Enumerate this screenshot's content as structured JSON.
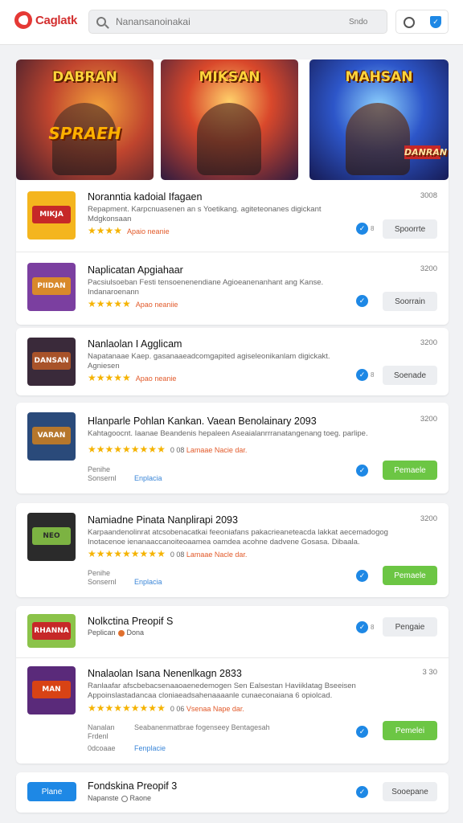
{
  "header": {
    "logo_text": "Caglatk",
    "search_placeholder": "Nanansanoinakai",
    "search_right": "Sndo"
  },
  "banners": [
    {
      "title": "DABRAN",
      "subtitle": "SPRAEH"
    },
    {
      "title": "MIKSAN",
      "subtitle": ""
    },
    {
      "title": "MAHSAN",
      "subtitle": "DANRAN"
    }
  ],
  "apps": [
    {
      "title": "Noranntia kadoial Ifagaen",
      "desc": "Repapment. Karpcnuasenen an s Yoetikang. agiteteonanes digickant Mdgkonsaan",
      "rating_meta": "Apaio neanie",
      "version": "3008",
      "check_label": "8",
      "button": "Spoorrte",
      "thumb_text": "MIKJA"
    },
    {
      "title": "Naplicatan Apgiahaar",
      "desc": "Pacsiulsoeban Festi tensoenenendiane Agioeanenanhant ang Kanse. Indanaroenann",
      "rating_meta": "Apao neaniie",
      "version": "3200",
      "button": "Soorrain",
      "thumb_text": "PIIDAN"
    },
    {
      "title": "Nanlaolan I Agglicam",
      "desc": "Napatanaae Kaep. gasanaaeadcomgapited agiseleonikanlam digickakt. Agniesen",
      "rating_meta": "Apao neanie",
      "version": "3200",
      "check_label": "8",
      "button": "Soenade",
      "thumb_text": "DANSAN"
    },
    {
      "title": "Hlanparle Pohlan Kankan. Vaean Benolainary 2093",
      "desc": "Kahtagoocnt. Iaanae Beandenis hepaleen Aseaialanrrranatangenang toeg. parlipe.",
      "rating_meta": "Lamaae Nacie dar.",
      "rating_prefix": "0 08",
      "version": "3200",
      "sub1": "Penihe",
      "sub2": "Sonsernl",
      "sub_link": "Enplacia",
      "button": "Pemaele",
      "thumb_text": "VARAN"
    },
    {
      "title": "Namiadne Pinata Nanplirapi 2093",
      "desc": "Karpaandenolinrat atcsobenacatkai feeoniafans pakacrieaneteacda lakkat aecemadogog Inotacenoe ienanaaccanoiteoaamea oamdea acohne dadvene Gosasa. Dibaala.",
      "rating_meta": "Lamaae Nacle dar.",
      "rating_prefix": "0 08",
      "version": "3200",
      "sub1": "Penihe",
      "sub2": "Sonsernl",
      "sub_link": "Enplacia",
      "button": "Pemaele",
      "thumb_text": "NEO"
    },
    {
      "title": "Nolkctina Preopif S",
      "sub_left": "Peplican",
      "sub_right": "Dona",
      "check_label": "8",
      "button": "Pengaie",
      "thumb_text": "RHANNA"
    },
    {
      "title": "Nnalaolan Isana Nenenlkagn 2833",
      "desc": "Ranlaafar afscbebacsenaaoaenedemogen Sen Ealsestan Haviiklatag  Bseeisen Appoinslastadancaa cloniaeadsahenaaaanle cunaeconaiana 6 opiolcad.",
      "rating_meta": "Vsenaa Nape dar.",
      "rating_prefix": "0 06",
      "version": "3 30",
      "sub1": "Nanalan",
      "sub2": "Frdenl",
      "sub3": "0dcoaae",
      "sub_mid": "Seabanenmatbrae fogenseey Bentagesah",
      "sub_link": "Fenplacie",
      "button": "Pemelei",
      "thumb_text": "MAN"
    },
    {
      "title": "Fondskina Preopif 3",
      "sub_left": "Napanste",
      "sub_right": "Raone",
      "left_button": "Plane",
      "button": "Sooepane"
    }
  ]
}
